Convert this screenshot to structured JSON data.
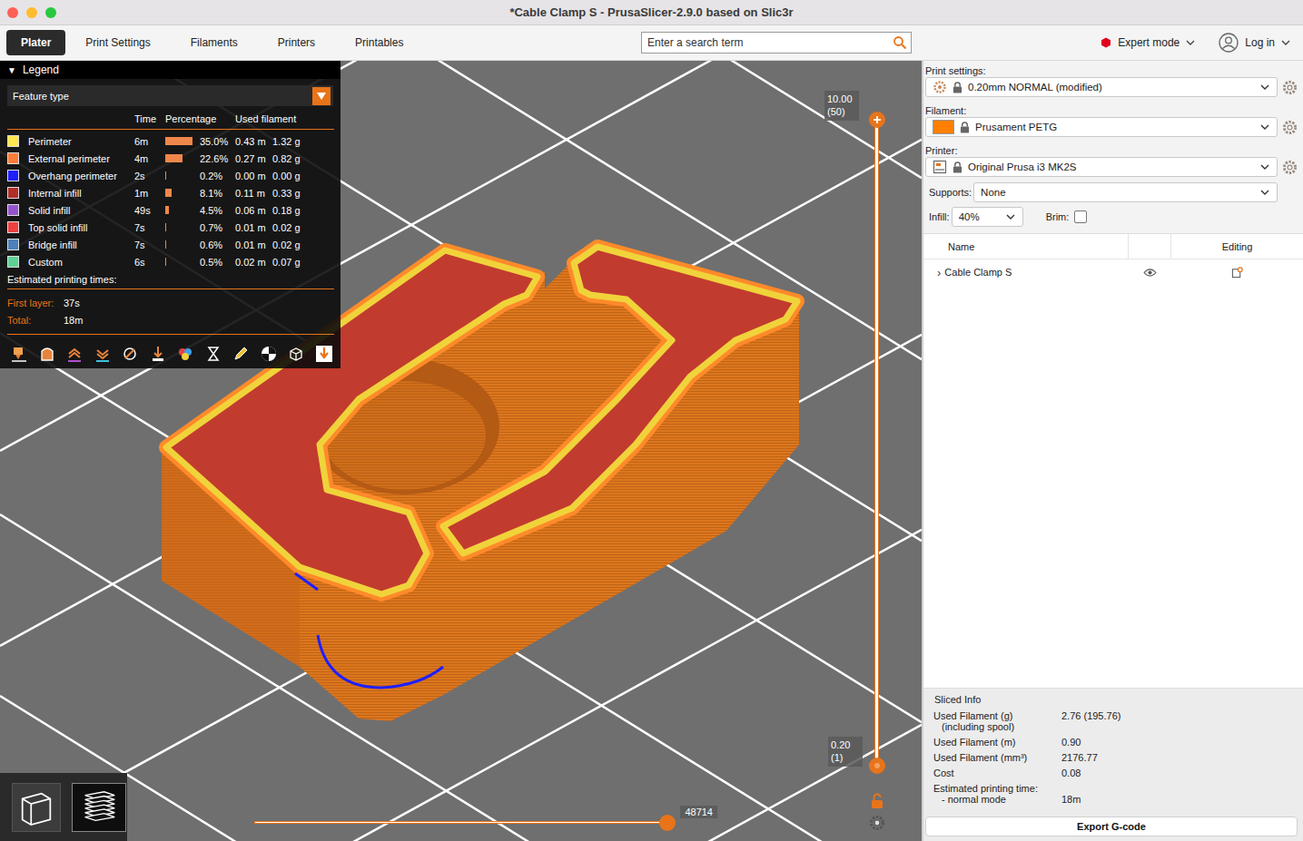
{
  "window": {
    "title": "*Cable Clamp S - PrusaSlicer-2.9.0 based on Slic3r"
  },
  "tabs": [
    {
      "label": "Plater",
      "selected": true
    },
    {
      "label": "Print Settings",
      "selected": false
    },
    {
      "label": "Filaments",
      "selected": false
    },
    {
      "label": "Printers",
      "selected": false
    },
    {
      "label": "Printables",
      "selected": false
    }
  ],
  "search": {
    "placeholder": "Enter a search term"
  },
  "mode": {
    "label": "Expert mode"
  },
  "account": {
    "label": "Log in"
  },
  "legend": {
    "toggle": "▼",
    "title": "Legend",
    "view_type": "Feature type",
    "columns": [
      "Time",
      "Percentage",
      "Used filament"
    ],
    "rows": [
      {
        "name": "Perimeter",
        "color": "#ffe64d",
        "time": "6m",
        "percentage": "35.0%",
        "level": 1,
        "length": "0.43 m",
        "weight": "1.32 g"
      },
      {
        "name": "External perimeter",
        "color": "#ff7d38",
        "time": "4m",
        "percentage": "22.6%",
        "level": 0.646,
        "length": "0.27 m",
        "weight": "0.82 g"
      },
      {
        "name": "Overhang perimeter",
        "color": "#1f1fff",
        "time": "2s",
        "percentage": "0.2%",
        "level": 0.006,
        "length": "0.00 m",
        "weight": "0.00 g"
      },
      {
        "name": "Internal infill",
        "color": "#b03029",
        "time": "1m",
        "percentage": "8.1%",
        "level": 0.231,
        "length": "0.11 m",
        "weight": "0.33 g"
      },
      {
        "name": "Solid infill",
        "color": "#9654cc",
        "time": "49s",
        "percentage": "4.5%",
        "level": 0.129,
        "length": "0.06 m",
        "weight": "0.18 g"
      },
      {
        "name": "Top solid infill",
        "color": "#f04040",
        "time": "7s",
        "percentage": "0.7%",
        "level": 0.02,
        "length": "0.01 m",
        "weight": "0.02 g"
      },
      {
        "name": "Bridge infill",
        "color": "#4d80ba",
        "time": "7s",
        "percentage": "0.6%",
        "level": 0.017,
        "length": "0.01 m",
        "weight": "0.02 g"
      },
      {
        "name": "Custom",
        "color": "#5ed194",
        "time": "6s",
        "percentage": "0.5%",
        "level": 0.014,
        "length": "0.02 m",
        "weight": "0.07 g"
      }
    ],
    "times_title": "Estimated printing times:",
    "times": [
      {
        "label": "First layer:",
        "value": "37s"
      },
      {
        "label": "Total:",
        "value": "18m"
      }
    ]
  },
  "layer_slider": {
    "top": {
      "value": "10.00",
      "layer": "(50)",
      "level": 1
    },
    "bottom": {
      "value": "0.20",
      "layer": "(1)",
      "level": 0
    },
    "locked": false
  },
  "move_slider": {
    "value": "48714",
    "level": 0.99
  },
  "view_toggle": [
    {
      "kind": "3d",
      "selected": false
    },
    {
      "kind": "preview",
      "selected": true
    }
  ],
  "sidebar": {
    "print_settings": {
      "label": "Print settings:",
      "value": "0.20mm NORMAL (modified)",
      "locked": true
    },
    "filament": {
      "label": "Filament:",
      "value": "Prusament PETG",
      "color": "#ff8000",
      "locked": true
    },
    "printer": {
      "label": "Printer:",
      "value": "Original Prusa i3 MK2S",
      "locked": true
    },
    "supports": {
      "label": "Supports:",
      "value": "None"
    },
    "infill": {
      "label": "Infill:",
      "value": "40%"
    },
    "brim": {
      "label": "Brim:",
      "checked": false
    },
    "objects": {
      "columns": [
        "Name",
        "Editing"
      ],
      "rows": [
        {
          "expander": "›",
          "name": "Cable Clamp S",
          "visible": true,
          "expanded": false
        }
      ]
    },
    "sliced_info": {
      "title": "Sliced Info",
      "rows": [
        {
          "label": "Used Filament (g)",
          "sub": "(including spool)",
          "value": "2.76 (195.76)",
          "kind": "top"
        },
        {
          "label": "Used Filament (m)",
          "sub": "",
          "value": "0.90",
          "kind": "top"
        },
        {
          "label": "Used Filament (mm³)",
          "sub": "",
          "value": "2176.77",
          "kind": "top"
        },
        {
          "label": "Cost",
          "sub": "",
          "value": "0.08",
          "kind": "top"
        },
        {
          "label": "Estimated printing time:",
          "sub": "- normal mode",
          "value": "18m",
          "kind": "bottom"
        }
      ]
    },
    "export": {
      "label": "Export G-code"
    }
  }
}
